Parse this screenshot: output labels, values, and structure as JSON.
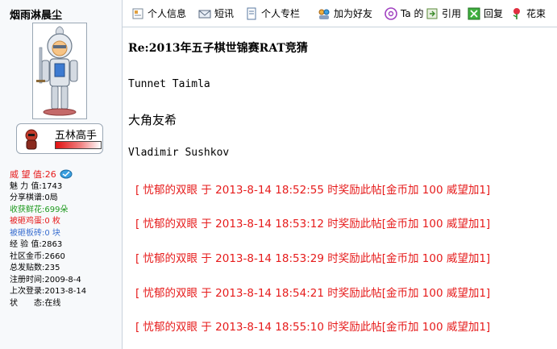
{
  "user": {
    "name": "烟雨淋晨尘",
    "rank": "五林高手",
    "stats": [
      {
        "label": "威 望 值",
        "value": "26",
        "color": "red"
      },
      {
        "label": "魅 力 值",
        "value": "1743",
        "color": "black"
      },
      {
        "label": "分享棋谱",
        "value": "0局",
        "color": "black"
      },
      {
        "label": "收获鲜花",
        "value": "699朵",
        "color": "green"
      },
      {
        "label": "被砸鸡蛋",
        "value": "0 枚",
        "color": "red"
      },
      {
        "label": "被砸板砖",
        "value": "0 块",
        "color": "blue"
      },
      {
        "label": "经 验 值",
        "value": "2863",
        "color": "black"
      },
      {
        "label": "社区金币",
        "value": "2660",
        "color": "black"
      },
      {
        "label": "总发贴数",
        "value": "235",
        "color": "black"
      },
      {
        "label": "注册时间",
        "value": "2009-8-4",
        "color": "black"
      },
      {
        "label": "上次登录",
        "value": "2013-8-14",
        "color": "black"
      },
      {
        "label": "状　　态",
        "value": "在线",
        "color": "black"
      }
    ]
  },
  "toolbar": {
    "items": [
      {
        "label": "个人信息",
        "icon": "profile-card-icon"
      },
      {
        "label": "短讯",
        "icon": "message-icon"
      },
      {
        "label": "个人专栏",
        "icon": "column-icon"
      },
      {
        "label": "加为好友",
        "icon": "add-friend-icon"
      },
      {
        "label": "Ta 的",
        "icon": "at-icon"
      },
      {
        "label": "引用",
        "icon": "quote-icon"
      },
      {
        "label": "回复",
        "icon": "reply-icon"
      },
      {
        "label": "花束",
        "icon": "flower-icon"
      }
    ]
  },
  "post": {
    "title": "Re:2013年五子棋世锦赛RAT竞猜",
    "lines": [
      "Tunnet Taimla",
      "大角友希",
      "Vladimir Sushkov"
    ],
    "rewards": [
      "[ 忧郁的双眼 于 2013-8-14 18:52:55 时奖励此帖[金币加 100 威望加1]",
      "[ 忧郁的双眼 于 2013-8-14 18:53:12 时奖励此帖[金币加 100 威望加1]",
      "[ 忧郁的双眼 于 2013-8-14 18:53:29 时奖励此帖[金币加 100 威望加1]",
      "[ 忧郁的双眼 于 2013-8-14 18:54:21 时奖励此帖[金币加 100 威望加1]",
      "[ 忧郁的双眼 于 2013-8-14 18:55:10 时奖励此帖[金币加 100 威望加1]"
    ]
  },
  "colors": {
    "accent_red": "#e61b1b",
    "green": "#1e9a1e",
    "blue": "#3a6fd0"
  }
}
